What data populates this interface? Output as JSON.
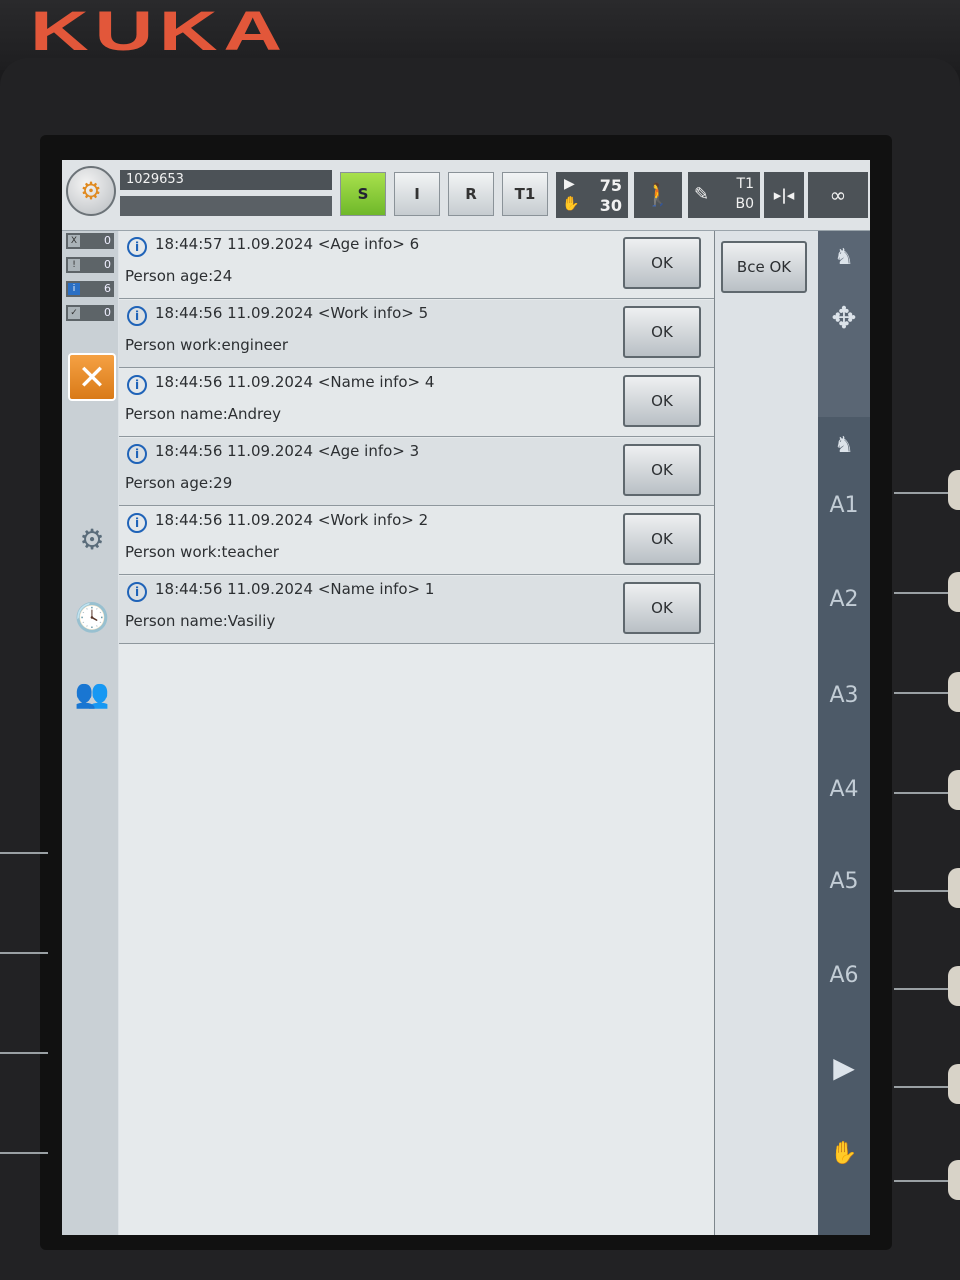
{
  "brand": "KUKA",
  "status_bar": {
    "robot_name": "1029653",
    "buttons": [
      "S",
      "I",
      "R",
      "T1"
    ],
    "override": {
      "prog_value": "75",
      "jog_value": "30"
    },
    "tool": {
      "tool_label": "T1",
      "base_label": "B0"
    },
    "infinity": "∞"
  },
  "counters": [
    {
      "icon": "X",
      "value": "0"
    },
    {
      "icon": "!",
      "value": "0"
    },
    {
      "icon": "i",
      "value": "6"
    },
    {
      "icon": "✓",
      "value": "0"
    }
  ],
  "messages": [
    {
      "time": "18:44:57 11.09.2024",
      "tag": "<Age info>",
      "num": "6",
      "text": "Person age:24",
      "ok": "OK"
    },
    {
      "time": "18:44:56 11.09.2024",
      "tag": "<Work info>",
      "num": "5",
      "text": "Person work:engineer",
      "ok": "OK"
    },
    {
      "time": "18:44:56 11.09.2024",
      "tag": "<Name info>",
      "num": "4",
      "text": "Person name:Andrey",
      "ok": "OK"
    },
    {
      "time": "18:44:56 11.09.2024",
      "tag": "<Age info>",
      "num": "3",
      "text": "Person age:29",
      "ok": "OK"
    },
    {
      "time": "18:44:56 11.09.2024",
      "tag": "<Work info>",
      "num": "2",
      "text": "Person work:teacher",
      "ok": "OK"
    },
    {
      "time": "18:44:56 11.09.2024",
      "tag": "<Name info>",
      "num": "1",
      "text": "Person name:Vasiliy",
      "ok": "OK"
    }
  ],
  "all_ok_label": "Все OK",
  "jog_axes": [
    "A1",
    "A2",
    "A3",
    "A4",
    "A5",
    "A6"
  ]
}
